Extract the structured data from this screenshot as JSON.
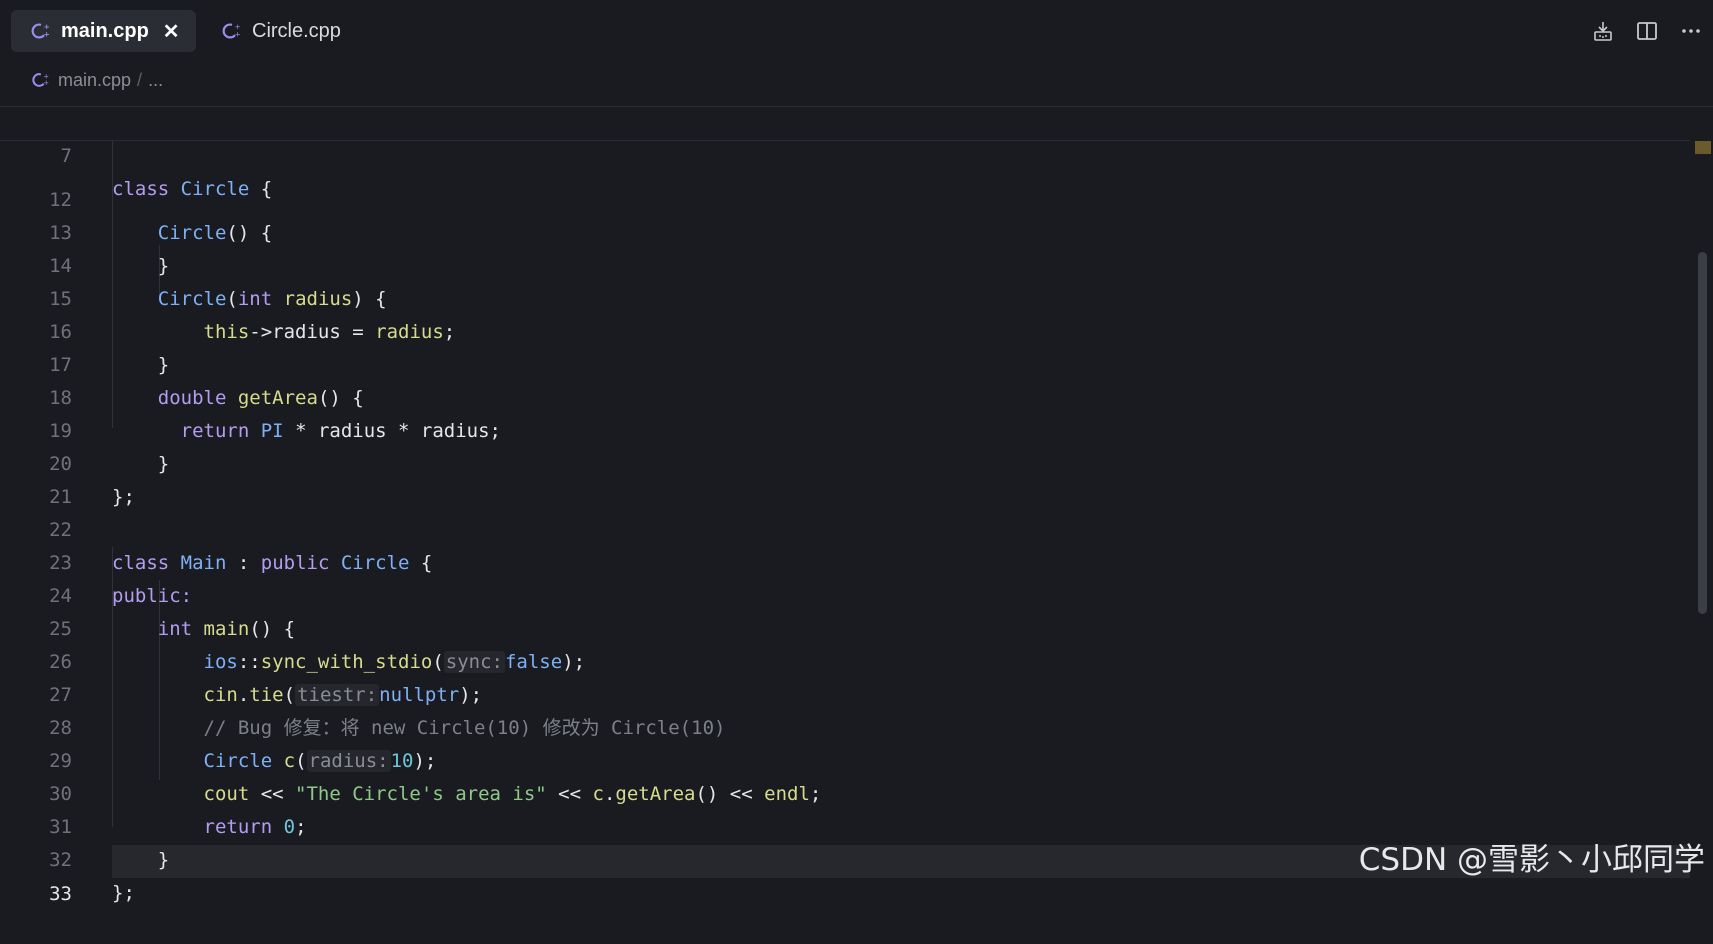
{
  "tabs": [
    {
      "label": "main.cpp",
      "active": true
    },
    {
      "label": "Circle.cpp",
      "active": false
    }
  ],
  "breadcrumb": {
    "file": "main.cpp",
    "separator": "/",
    "more": "..."
  },
  "sticky": {
    "line": "7",
    "code": "class Circle {"
  },
  "lines": [
    {
      "n": "12"
    },
    {
      "n": "13"
    },
    {
      "n": "14"
    },
    {
      "n": "15"
    },
    {
      "n": "16"
    },
    {
      "n": "17"
    },
    {
      "n": "18"
    },
    {
      "n": "19"
    },
    {
      "n": "20"
    },
    {
      "n": "21"
    },
    {
      "n": "22"
    },
    {
      "n": "23"
    },
    {
      "n": "24"
    },
    {
      "n": "25"
    },
    {
      "n": "26"
    },
    {
      "n": "27"
    },
    {
      "n": "28"
    },
    {
      "n": "29"
    },
    {
      "n": "30"
    },
    {
      "n": "31"
    },
    {
      "n": "32"
    },
    {
      "n": "33"
    }
  ],
  "code": {
    "l12": {
      "ctor": "Circle",
      "rest": "() {"
    },
    "l13": "}",
    "l14": {
      "ctor": "Circle",
      "open": "(",
      "type": "int",
      "param": "radius",
      "close": ") {"
    },
    "l15": {
      "kw": "this",
      "arrow": "->radius = ",
      "var": "radius",
      "semi": ";"
    },
    "l16": "}",
    "l17": {
      "type": "double",
      "fn": "getArea",
      "rest": "() {"
    },
    "l18": {
      "kw": "return",
      "const": "PI",
      "rest": " * radius * radius;"
    },
    "l19": "}",
    "l20": "};",
    "l22": {
      "kw": "class",
      "name": "Main",
      "colon": " : ",
      "access": "public",
      "base": "Circle",
      "brace": " {"
    },
    "l23": "public:",
    "l24": {
      "type": "int",
      "fn": "main",
      "rest": "() {"
    },
    "l25": {
      "ns": "ios",
      "sep": "::",
      "fn": "sync_with_stdio",
      "open": "(",
      "hint": "sync:",
      "val": "false",
      "close": ");"
    },
    "l26": {
      "obj": "cin",
      "dot": ".",
      "fn": "tie",
      "open": "(",
      "hint": "tiestr:",
      "val": "nullptr",
      "close": ");"
    },
    "l27": "// Bug 修复：将 new Circle(10) 修改为 Circle(10)",
    "l28": {
      "type": "Circle",
      "var": "c",
      "open": "(",
      "hint": "radius:",
      "val": "10",
      "close": ");"
    },
    "l29": {
      "obj": "cout",
      "op1": " << ",
      "str": "\"The Circle's area is\"",
      "op2": " << ",
      "var": "c",
      "dot": ".",
      "fn": "getArea",
      "call": "()",
      "op3": " << ",
      "endl": "endl",
      "semi": ";"
    },
    "l30": {
      "kw": "return",
      "val": "0",
      "semi": ";"
    },
    "l31": "}",
    "l32": "};"
  },
  "watermark": "CSDN @雪影丶小邱同学",
  "colors": {
    "background": "#1a1b20",
    "keyword": "#b49cf0",
    "type": "#7db0f5",
    "function": "#d6db8e",
    "string": "#8ec98a"
  }
}
